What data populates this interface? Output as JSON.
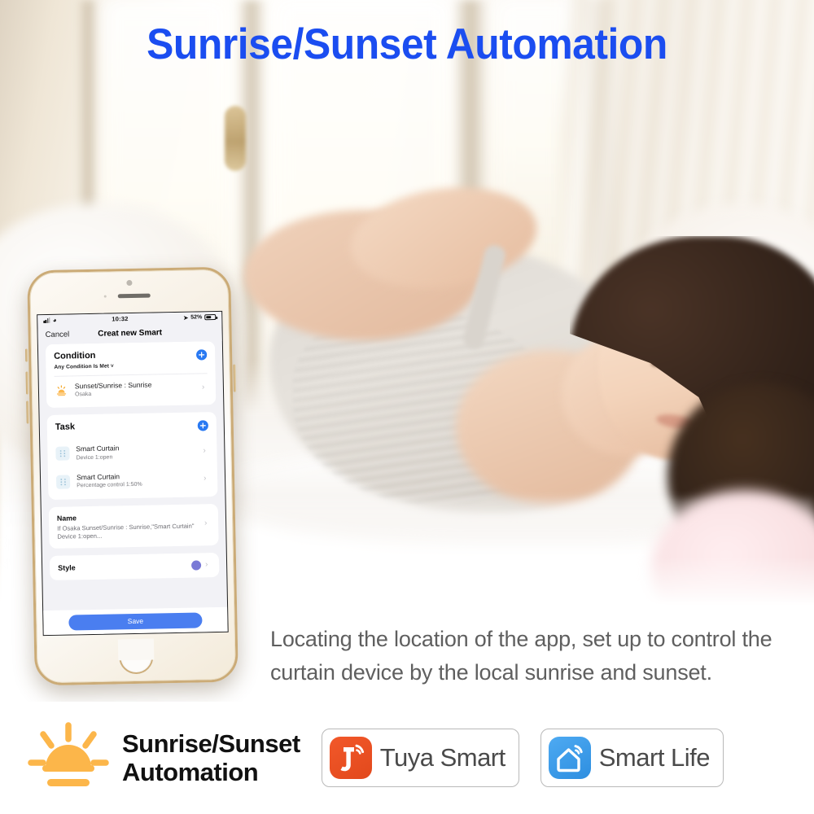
{
  "headline": "Sunrise/Sunset Automation",
  "description": "Locating the location of the app, set up to control the curtain device by the local sunrise and sunset.",
  "phone": {
    "status_bar": {
      "time": "10:32",
      "battery_percent": "52%",
      "signal_icon": "signal-bars-icon",
      "wifi_icon": "wifi-icon",
      "location_icon": "location-arrow-icon",
      "battery_icon": "battery-icon"
    },
    "nav": {
      "cancel_label": "Cancel",
      "title": "Creat new Smart"
    },
    "condition_card": {
      "title": "Condition",
      "subtitle": "Any Condition Is Met ˅",
      "add_icon": "plus-circle-icon",
      "rows": [
        {
          "icon": "sunrise-icon",
          "title": "Sunset/Sunrise : Sunrise",
          "subtitle": "Osaka",
          "chevron": "chevron-right-icon"
        }
      ]
    },
    "task_card": {
      "title": "Task",
      "add_icon": "plus-circle-icon",
      "rows": [
        {
          "icon": "curtain-icon",
          "title": "Smart Curtain",
          "subtitle": "Device 1:open",
          "chevron": "chevron-right-icon"
        },
        {
          "icon": "curtain-icon",
          "title": "Smart Curtain",
          "subtitle": "Percentage control 1:50%",
          "chevron": "chevron-right-icon"
        }
      ]
    },
    "name_card": {
      "label": "Name",
      "value": "If Osaka Sunset/Sunrise : Sunrise,\"Smart Curtain\" Device 1:open...",
      "chevron": "chevron-right-icon"
    },
    "style_card": {
      "label": "Style",
      "swatch_color": "#7a7ad6",
      "chevron": "chevron-right-icon"
    },
    "save_label": "Save"
  },
  "brand_bar": {
    "sun_icon": "sunrise-icon",
    "label_line1": "Sunrise/Sunset",
    "label_line2": "Automation",
    "logos": [
      {
        "icon": "tuya-logo-icon",
        "text": "Tuya Smart"
      },
      {
        "icon": "smart-life-logo-icon",
        "text": "Smart Life"
      }
    ]
  },
  "colors": {
    "headline_blue": "#1b4df0",
    "accent_blue": "#2979f2",
    "save_blue": "#4a7ef0",
    "sun_amber": "#fcb64a",
    "tuya_orange": "#e8491c",
    "smartlife_blue": "#3d9ceb"
  }
}
